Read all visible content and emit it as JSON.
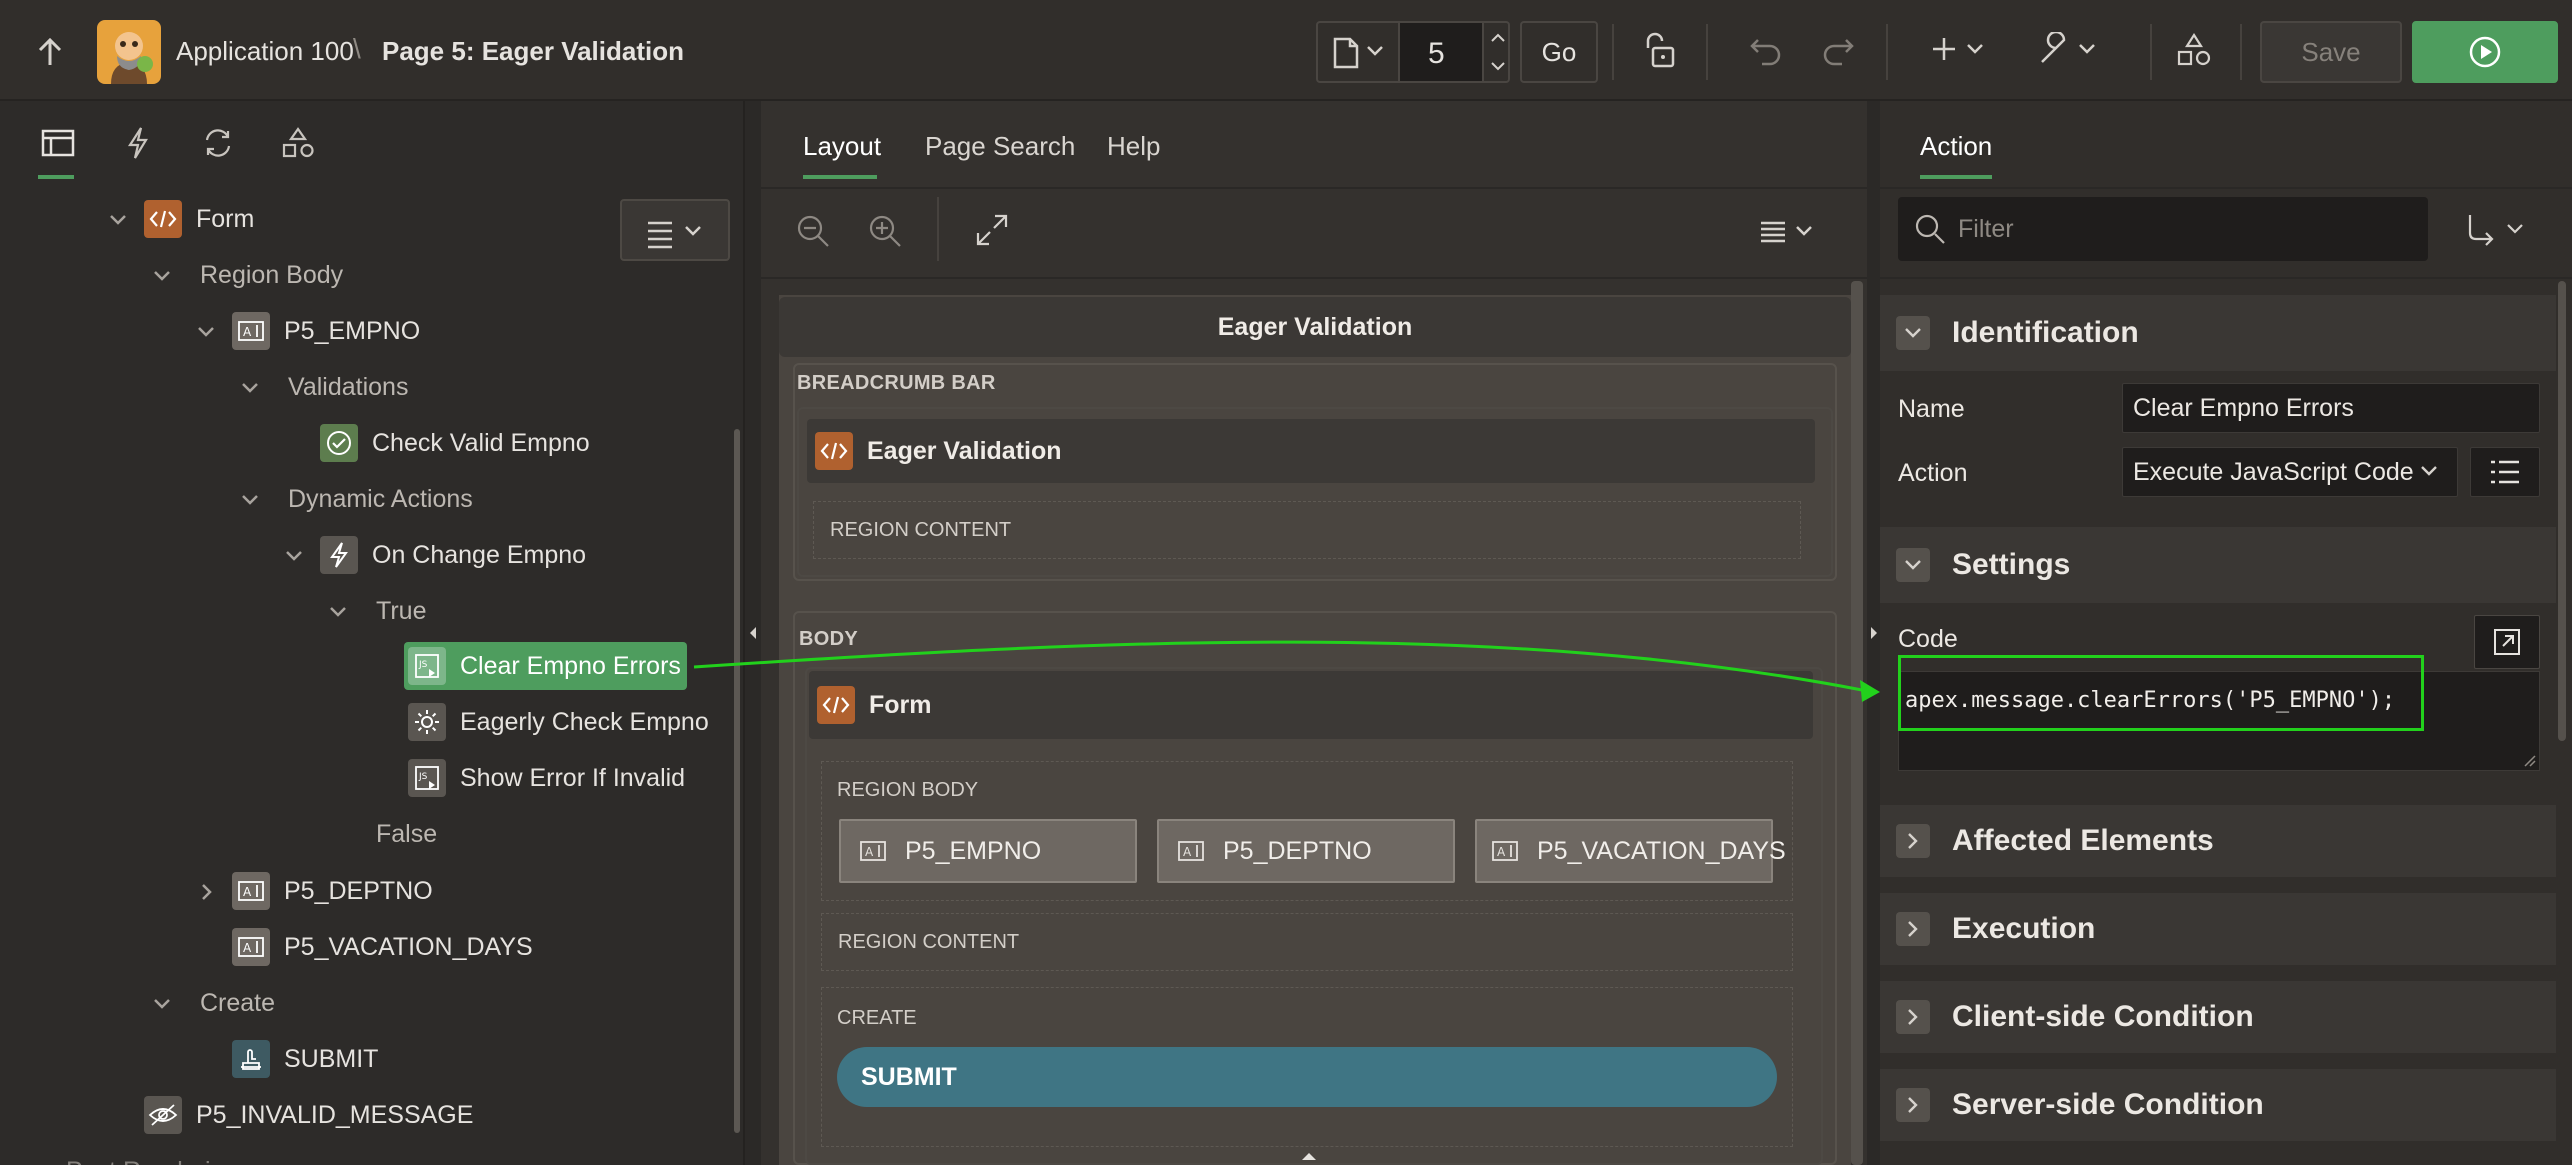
{
  "header": {
    "app_name": "Application 100",
    "separator": "\\",
    "page_title": "Page 5: Eager Validation",
    "page_number": "5",
    "go_label": "Go",
    "save_label": "Save"
  },
  "left_panel": {
    "tabs": [
      "rendering-tab",
      "dynamic-actions-tab",
      "processing-tab",
      "shared-components-tab"
    ],
    "tree": {
      "form": "Form",
      "region_body": "Region Body",
      "p5_empno": "P5_EMPNO",
      "validations": "Validations",
      "check_valid_empno": "Check Valid Empno",
      "dynamic_actions": "Dynamic Actions",
      "on_change_empno": "On Change Empno",
      "true_label": "True",
      "clear_empno_errors": "Clear Empno Errors",
      "eagerly_check_empno": "Eagerly Check Empno",
      "show_error_if_invalid": "Show Error If Invalid",
      "false_label": "False",
      "p5_deptno": "P5_DEPTNO",
      "p5_vacation_days": "P5_VACATION_DAYS",
      "create": "Create",
      "submit": "SUBMIT",
      "p5_invalid_message": "P5_INVALID_MESSAGE",
      "post_rendering": "Post Rendering"
    }
  },
  "center_panel": {
    "tabs": [
      "Layout",
      "Page Search",
      "Help"
    ],
    "page_header": "Eager Validation",
    "breadcrumb_bar": "BREADCRUMB BAR",
    "breadcrumb_region": "Eager Validation",
    "region_content": "REGION CONTENT",
    "body": "BODY",
    "form_region": "Form",
    "region_body": "REGION BODY",
    "items": [
      "P5_EMPNO",
      "P5_DEPTNO",
      "P5_VACATION_DAYS"
    ],
    "form_region_content": "REGION CONTENT",
    "create": "CREATE",
    "submit_button": "SUBMIT"
  },
  "right_panel": {
    "tab": "Action",
    "filter_placeholder": "Filter",
    "identification": "Identification",
    "name_label": "Name",
    "name_value": "Clear Empno Errors",
    "action_label": "Action",
    "action_value": "Execute JavaScript Code",
    "settings": "Settings",
    "code_label": "Code",
    "code_value": "apex.message.clearErrors('P5_EMPNO');",
    "sections": [
      "Affected Elements",
      "Execution",
      "Client-side Condition",
      "Server-side Condition"
    ]
  },
  "colors": {
    "accent_green": "#4e9d5e",
    "annotation_green": "#22d11c",
    "submit_teal": "#3f7584",
    "form_icon_orange": "#b0612f"
  }
}
